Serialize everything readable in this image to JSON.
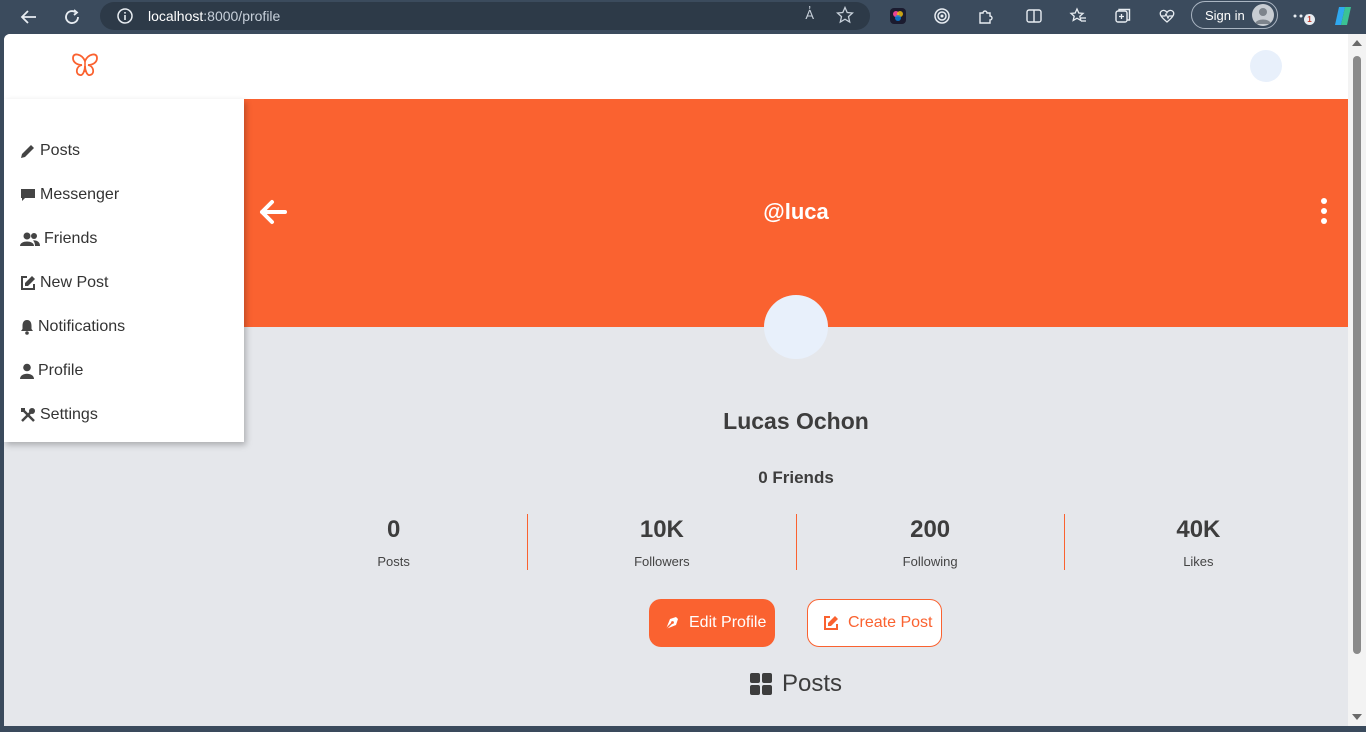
{
  "browser": {
    "url_host": "localhost",
    "url_path": ":8000/profile",
    "read_aloud": "A̓",
    "sign_in_label": "Sign in",
    "notification_count": "1"
  },
  "sidebar": {
    "items": [
      {
        "label": "Posts",
        "icon": "pencil-icon"
      },
      {
        "label": "Messenger",
        "icon": "message-icon"
      },
      {
        "label": "Friends",
        "icon": "users-icon"
      },
      {
        "label": "New Post",
        "icon": "edit-square-icon"
      },
      {
        "label": "Notifications",
        "icon": "bell-icon"
      },
      {
        "label": "Profile",
        "icon": "user-icon"
      },
      {
        "label": "Settings",
        "icon": "tools-icon"
      }
    ]
  },
  "profile": {
    "handle": "@luca",
    "name": "Lucas Ochon",
    "friends_text": "0 Friends",
    "stats": [
      {
        "value": "0",
        "label": "Posts"
      },
      {
        "value": "10K",
        "label": "Followers"
      },
      {
        "value": "200",
        "label": "Following"
      },
      {
        "value": "40K",
        "label": "Likes"
      }
    ],
    "edit_button": "Edit Profile",
    "create_button": "Create Post",
    "posts_heading": "Posts"
  },
  "colors": {
    "accent": "#fa6230",
    "background": "#e5e7eb",
    "chrome": "#3b4b5d"
  }
}
